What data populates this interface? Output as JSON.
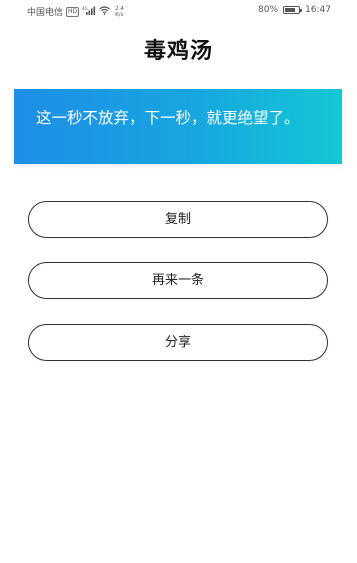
{
  "status_bar": {
    "carrier": "中国电信",
    "hd": "HD",
    "signal_label": "⁴ᴳ",
    "net_speed_value": "2.4",
    "net_speed_unit": "K/s",
    "battery_percent": "80%",
    "battery_level": 0.8,
    "time": "16:47"
  },
  "header": {
    "title": "毒鸡汤"
  },
  "quote": {
    "text": "这一秒不放弃，下一秒，就更绝望了。"
  },
  "actions": {
    "copy_label": "复制",
    "next_label": "再来一条",
    "share_label": "分享"
  },
  "colors": {
    "card_gradient_start": "#1e8ee6",
    "card_gradient_end": "#14c7d4"
  }
}
